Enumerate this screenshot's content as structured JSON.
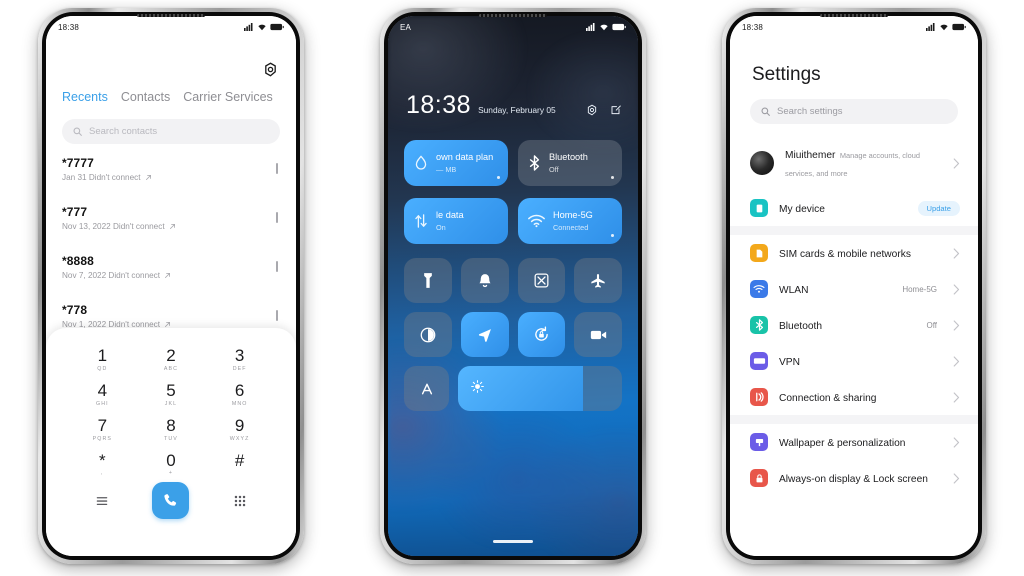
{
  "phone1": {
    "status": {
      "time": "18:38",
      "icons": [
        "signal-icon",
        "wifi-icon",
        "battery-icon"
      ]
    },
    "settings_icon": "gear-icon",
    "tabs": [
      {
        "label": "Recents",
        "active": true
      },
      {
        "label": "Contacts",
        "active": false
      },
      {
        "label": "Carrier Services",
        "active": false
      }
    ],
    "search": {
      "placeholder": "Search contacts",
      "icon": "search-icon"
    },
    "calls": [
      {
        "number": "*7777",
        "detail": "Jan 31 Didn't connect",
        "type_icon": "outgoing-arrow-icon"
      },
      {
        "number": "*777",
        "detail": "Nov 13, 2022 Didn't connect",
        "type_icon": "outgoing-arrow-icon"
      },
      {
        "number": "*8888",
        "detail": "Nov 7, 2022 Didn't connect",
        "type_icon": "outgoing-arrow-icon"
      },
      {
        "number": "*778",
        "detail": "Nov 1, 2022 Didn't connect",
        "type_icon": "outgoing-arrow-icon"
      }
    ],
    "keypad": [
      {
        "digit": "1",
        "letters": "QD"
      },
      {
        "digit": "2",
        "letters": "ABC"
      },
      {
        "digit": "3",
        "letters": "DEF"
      },
      {
        "digit": "4",
        "letters": "GHI"
      },
      {
        "digit": "5",
        "letters": "JKL"
      },
      {
        "digit": "6",
        "letters": "MNO"
      },
      {
        "digit": "7",
        "letters": "PQRS"
      },
      {
        "digit": "8",
        "letters": "TUV"
      },
      {
        "digit": "9",
        "letters": "WXYZ"
      },
      {
        "digit": "*",
        "letters": ","
      },
      {
        "digit": "0",
        "letters": "+"
      },
      {
        "digit": "#",
        "letters": ""
      }
    ],
    "actions": {
      "left_icon": "menu-lines-icon",
      "call_icon": "phone-handset-icon",
      "right_icon": "keypad-grid-icon"
    },
    "accent": "#3ba0e8"
  },
  "phone2": {
    "status": {
      "carrier": "EA",
      "icons": [
        "signal-icon",
        "wifi-icon",
        "battery-icon"
      ]
    },
    "clock": {
      "time": "18:38",
      "date": "Sunday, February 05"
    },
    "clock_icons": [
      "settings-gear-icon",
      "edit-pencil-icon"
    ],
    "tiles_big": [
      {
        "title": "own data plan",
        "subtitle": "— MB",
        "icon": "data-drop-icon",
        "state": "on",
        "has_dot": true
      },
      {
        "title": "Bluetooth",
        "subtitle": "Off",
        "icon": "bluetooth-icon",
        "state": "off",
        "has_dot": true
      },
      {
        "title": "le data",
        "subtitle": "On",
        "icon": "mobile-data-arrows-icon",
        "state": "on",
        "has_dot": false
      },
      {
        "title": "Home-5G",
        "subtitle": "Connected",
        "icon": "wifi-icon",
        "state": "on",
        "has_dot": true
      }
    ],
    "tiles_small_row1": [
      {
        "icon": "flashlight-icon",
        "state": "off"
      },
      {
        "icon": "bell-icon",
        "state": "off"
      },
      {
        "icon": "screenshot-scissors-icon",
        "state": "off"
      },
      {
        "icon": "airplane-icon",
        "state": "off"
      }
    ],
    "tiles_small_row2": [
      {
        "icon": "dark-mode-contrast-icon",
        "state": "off"
      },
      {
        "icon": "location-arrow-icon",
        "state": "on"
      },
      {
        "icon": "rotation-lock-icon",
        "state": "on"
      },
      {
        "icon": "screen-recorder-camera-icon",
        "state": "off"
      }
    ],
    "auto_brightness": {
      "icon": "auto-brightness-a-icon",
      "state": "off"
    },
    "brightness_slider": {
      "icon": "brightness-sun-icon",
      "value_percent": 76
    },
    "home_indicator": "home-bar"
  },
  "phone3": {
    "status": {
      "time": "18:38",
      "icons": [
        "signal-icon",
        "wifi-icon",
        "battery-icon"
      ]
    },
    "title": "Settings",
    "search": {
      "placeholder": "Search settings",
      "icon": "search-icon"
    },
    "account": {
      "name": "Miuithemer",
      "subtitle": "Manage accounts, cloud services, and more",
      "avatar": "account-avatar"
    },
    "device": {
      "label": "My device",
      "badge": "Update",
      "icon": "device-phone-icon",
      "color": "#19c3c3"
    },
    "groups": [
      [
        {
          "label": "SIM cards & mobile networks",
          "value": "",
          "icon": "sim-card-icon",
          "color": "#f3a81b"
        },
        {
          "label": "WLAN",
          "value": "Home-5G",
          "icon": "wifi-icon",
          "color": "#3b7ae8"
        },
        {
          "label": "Bluetooth",
          "value": "Off",
          "icon": "bluetooth-icon",
          "color": "#19c3a8"
        },
        {
          "label": "VPN",
          "value": "",
          "icon": "vpn-icon",
          "color": "#6b5ce7"
        },
        {
          "label": "Connection & sharing",
          "value": "",
          "icon": "connection-sharing-icon",
          "color": "#e8564a"
        }
      ],
      [
        {
          "label": "Wallpaper & personalization",
          "value": "",
          "icon": "wallpaper-brush-icon",
          "color": "#6b5ce7"
        },
        {
          "label": "Always-on display & Lock screen",
          "value": "",
          "icon": "lock-screen-icon",
          "color": "#e8564a"
        }
      ]
    ],
    "accent": "#3ba0e8"
  }
}
